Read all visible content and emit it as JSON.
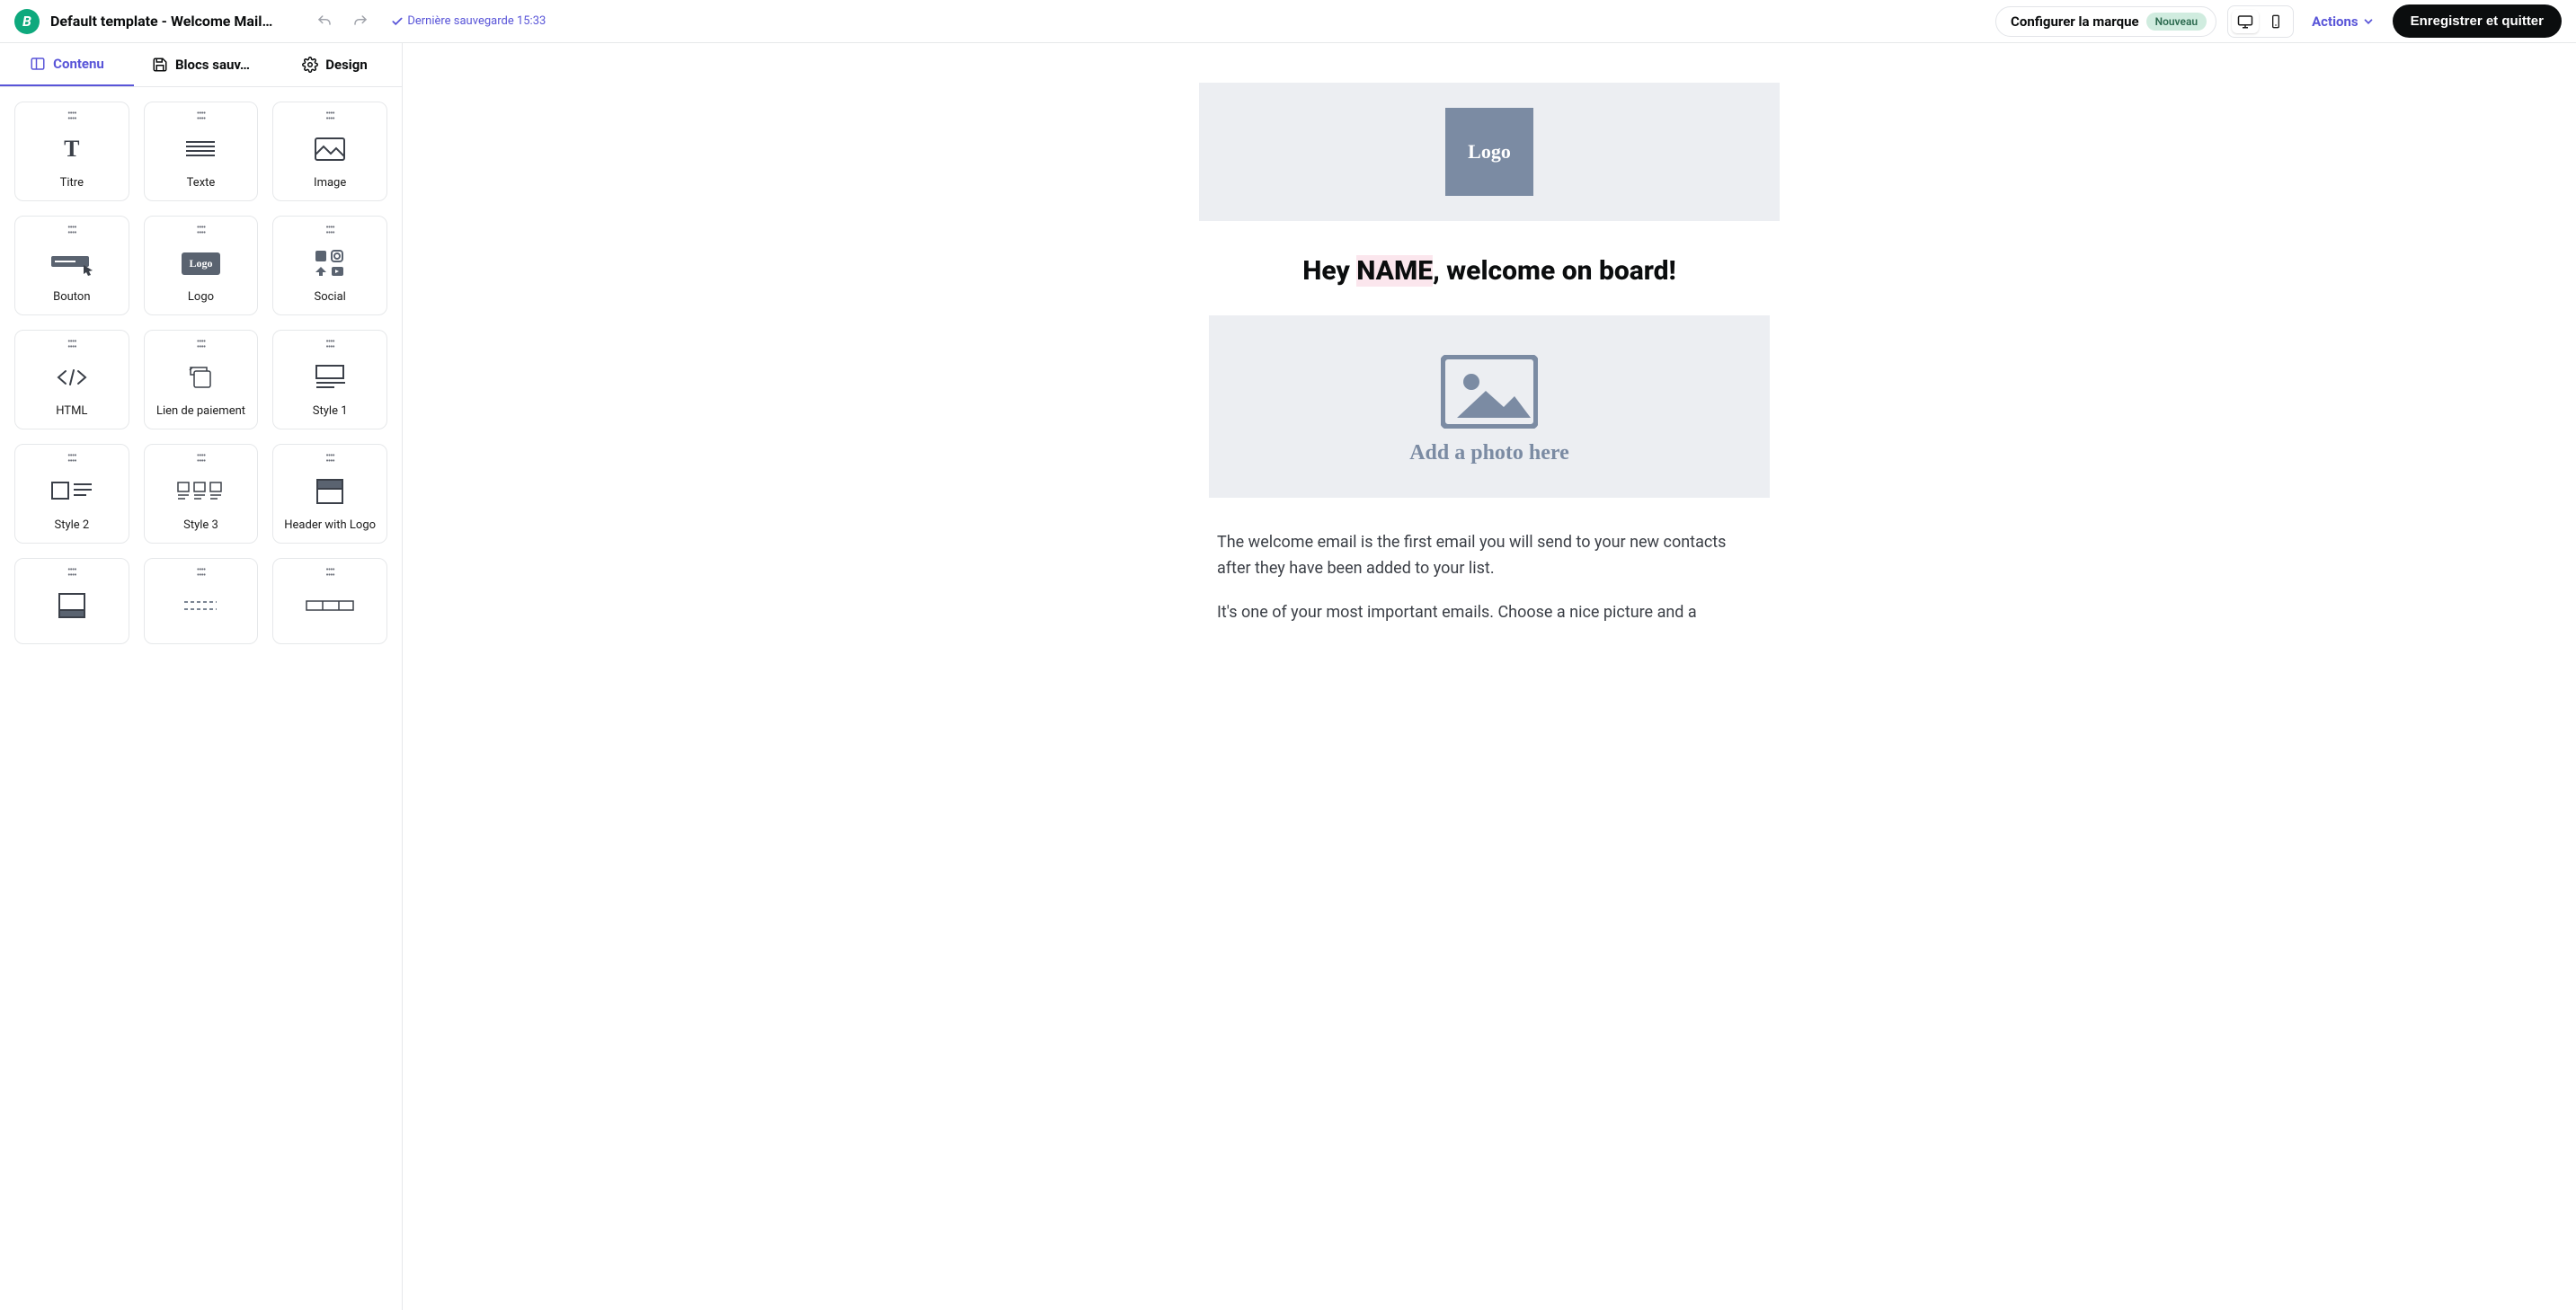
{
  "header": {
    "logo_letter": "B",
    "title": "Default template - Welcome Mail…",
    "save_status": "Dernière sauvegarde 15:33",
    "brand_label": "Configurer la marque",
    "brand_badge": "Nouveau",
    "actions_label": "Actions",
    "save_exit_label": "Enregistrer et quitter"
  },
  "tabs": {
    "content": "Contenu",
    "saved": "Blocs sauv…",
    "design": "Design"
  },
  "blocks": [
    {
      "id": "titre",
      "label": "Titre"
    },
    {
      "id": "texte",
      "label": "Texte"
    },
    {
      "id": "image",
      "label": "Image"
    },
    {
      "id": "bouton",
      "label": "Bouton"
    },
    {
      "id": "logo",
      "label": "Logo"
    },
    {
      "id": "social",
      "label": "Social"
    },
    {
      "id": "html",
      "label": "HTML"
    },
    {
      "id": "paiement",
      "label": "Lien de paiement"
    },
    {
      "id": "style1",
      "label": "Style 1"
    },
    {
      "id": "style2",
      "label": "Style 2"
    },
    {
      "id": "style3",
      "label": "Style 3"
    },
    {
      "id": "header-logo",
      "label": "Header with Logo"
    },
    {
      "id": "row14",
      "label": ""
    },
    {
      "id": "row15",
      "label": ""
    },
    {
      "id": "row16",
      "label": ""
    }
  ],
  "canvas": {
    "logo_text": "Logo",
    "headline_prefix": "Hey ",
    "headline_name": "NAME",
    "headline_suffix": ", welcome on board!",
    "photo_caption": "Add a photo here",
    "paragraph1": "The welcome email is the first email you will send to your new contacts after they have been added to your list.",
    "paragraph2": "It's one of your most important emails. Choose a nice picture and a"
  }
}
